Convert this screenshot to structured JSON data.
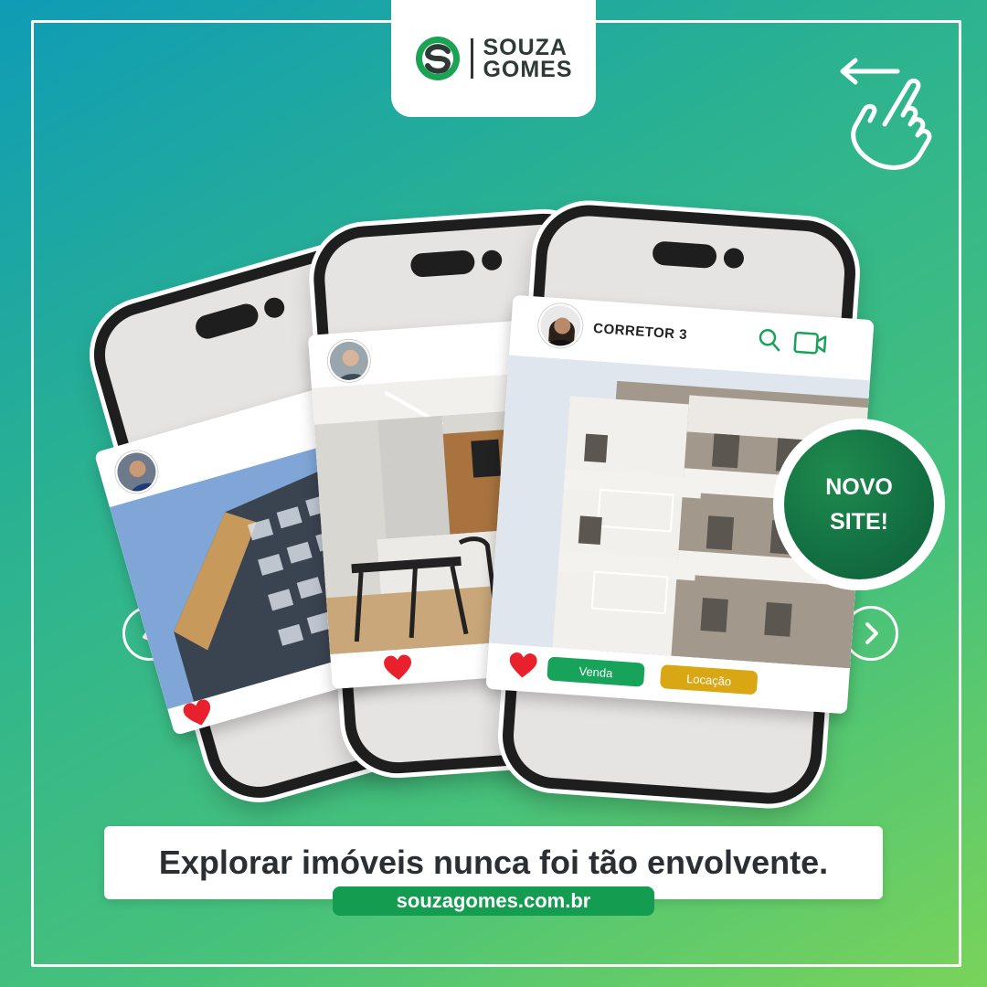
{
  "brand": {
    "line1": "SOUZA",
    "line2": "GOMES",
    "icon": "sg-logo-icon"
  },
  "colors": {
    "green": "#17a35a",
    "yellow": "#d9a614",
    "dark_green": "#137143",
    "heart": "#e8212c"
  },
  "cards": {
    "agent3_name": "CORRETOR 3",
    "tag_sale": "Venda",
    "tag_rent": "Locação"
  },
  "badge": {
    "line1": "NOVO",
    "line2": "SITE!"
  },
  "footer": {
    "tagline": "Explorar imóveis nunca foi tão envolvente.",
    "url": "souzagomes.com.br"
  },
  "icons": [
    "swipe-hand-icon",
    "arrow-left-icon",
    "chevron-left-icon",
    "chevron-right-icon",
    "search-icon",
    "video-camera-icon",
    "heart-icon"
  ]
}
